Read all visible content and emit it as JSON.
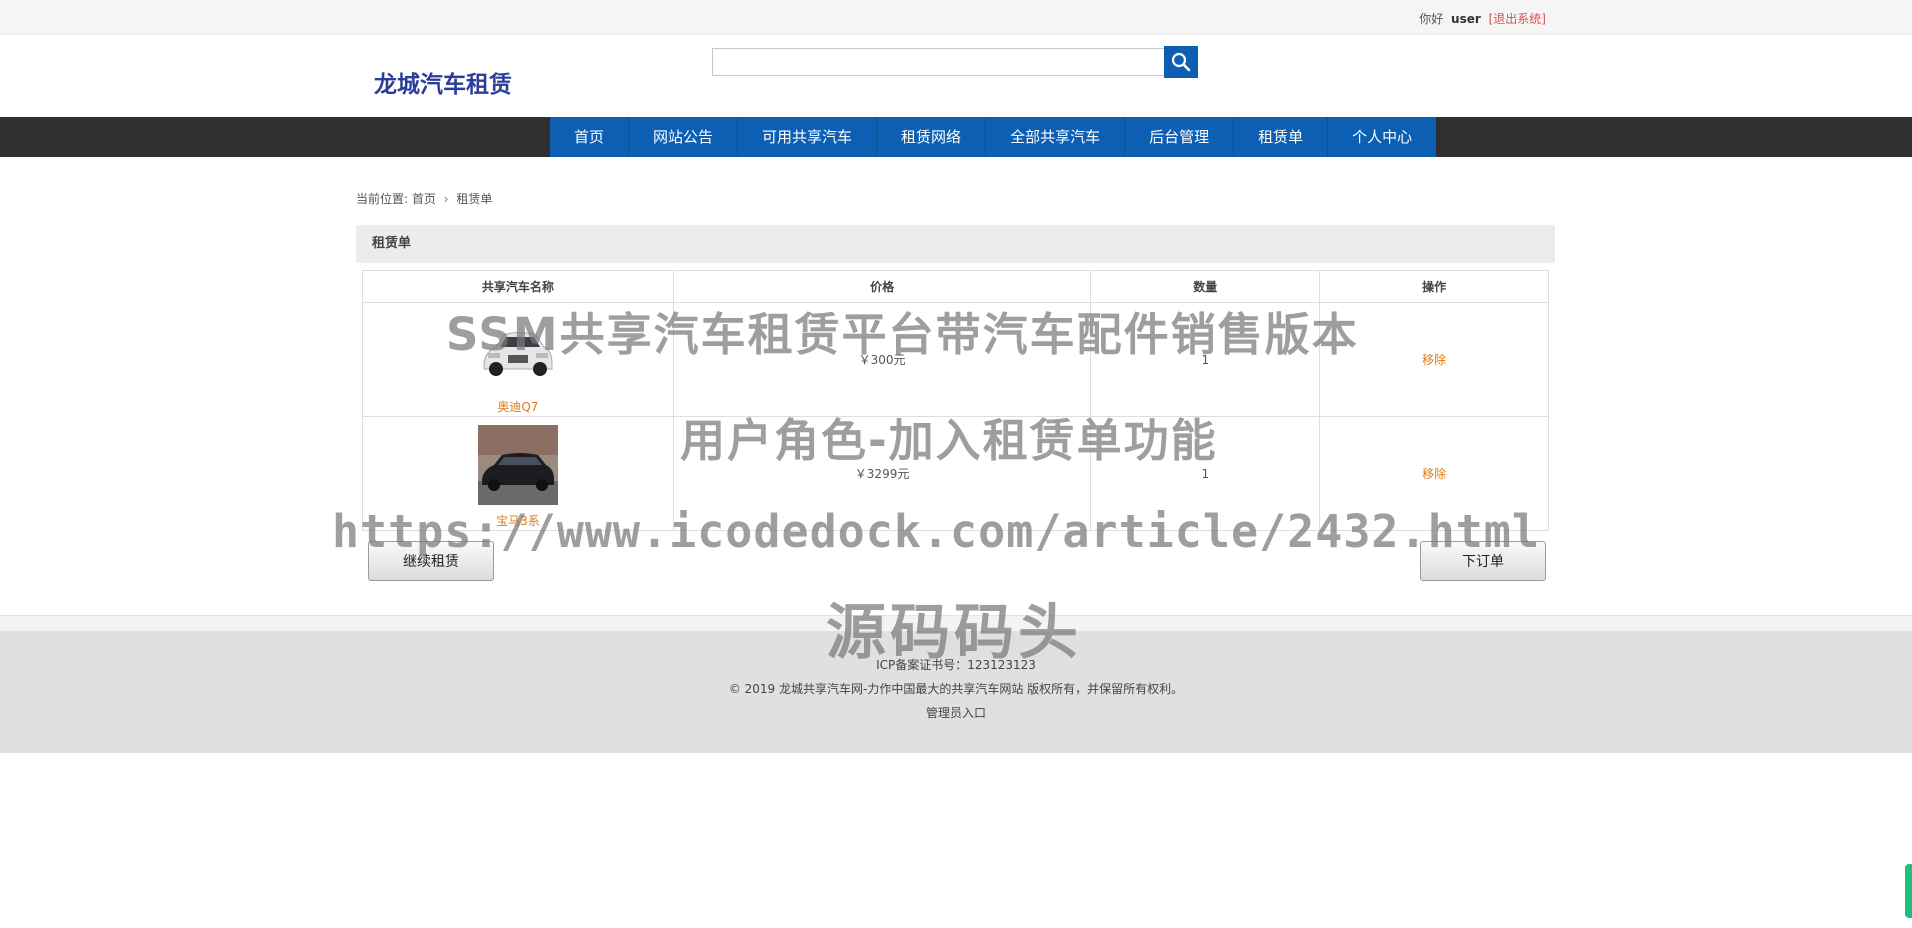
{
  "topbar": {
    "greeting": "你好",
    "username": "user",
    "logout": "[退出系统]"
  },
  "header": {
    "logo": "龙城汽车租赁",
    "search_placeholder": "",
    "search_icon": "search-icon"
  },
  "nav": {
    "items": [
      "首页",
      "网站公告",
      "可用共享汽车",
      "租赁网络",
      "全部共享汽车",
      "后台管理",
      "租赁单",
      "个人中心"
    ]
  },
  "breadcrumb": {
    "prefix": "当前位置:",
    "home": "首页",
    "current": "租赁单"
  },
  "panel": {
    "title": "租赁单"
  },
  "table": {
    "headers": [
      "共享汽车名称",
      "价格",
      "数量",
      "操作"
    ],
    "rows": [
      {
        "name": "奥迪Q7",
        "price": "￥300元",
        "qty": "1",
        "action": "移除",
        "car_color": "#e6e6e6"
      },
      {
        "name": "宝马3系",
        "price": "￥3299元",
        "qty": "1",
        "action": "移除",
        "car_color": "#1c1c22"
      }
    ]
  },
  "actions": {
    "continue": "继续租赁",
    "order": "下订单"
  },
  "footer": {
    "icp": "ICP备案证书号：123123123",
    "copyright": "© 2019 龙城共享汽车网-力作中国最大的共享汽车网站 版权所有，并保留所有权利。",
    "admin": "管理员入口"
  },
  "watermark": {
    "line1": "SSM共享汽车租赁平台带汽车配件销售版本",
    "line2": "用户角色-加入租赁单功能",
    "line3": "https://www.icodedock.com/article/2432.html",
    "line4": "源码码头"
  },
  "colors": {
    "nav_blue": "#0c5fb3",
    "nav_bar": "#2f2f2f",
    "logo": "#2c3d99",
    "link_orange": "#e07a10",
    "logout_red": "#d9534f"
  }
}
